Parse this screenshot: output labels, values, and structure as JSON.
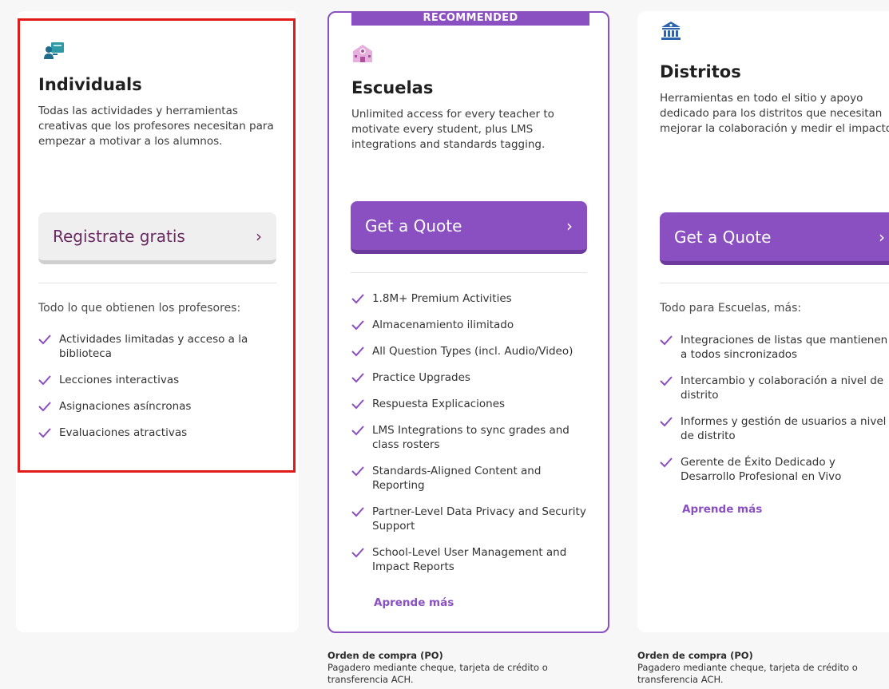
{
  "individuals": {
    "title": "Individuals",
    "description": "Todas las actividades y herramientas creativas que los profesores necesitan para empezar a motivar a los alumnos.",
    "button_label": "Registrate gratis",
    "section_head": "Todo lo que obtienen los profesores:",
    "features": [
      "Actividades limitadas y acceso a la biblioteca",
      "Lecciones interactivas",
      "Asignaciones asíncronas",
      "Evaluaciones atractivas"
    ]
  },
  "escuelas": {
    "badge": "RECOMMENDED",
    "title": "Escuelas",
    "description": "Unlimited access for every teacher to motivate every student, plus LMS integrations and standards tagging.",
    "button_label": "Get a Quote",
    "features": [
      "1.8M+ Premium Activities",
      "Almacenamiento ilimitado",
      "All Question Types (incl. Audio/Video)",
      "Practice Upgrades",
      "Respuesta Explicaciones",
      "LMS Integrations to sync grades and class rosters",
      "Standards-Aligned Content and Reporting",
      "Partner-Level Data Privacy and Security Support",
      "School-Level User Management and Impact Reports"
    ],
    "link": "Aprende más",
    "note_head": "Orden de compra (PO)",
    "note_body": "Pagadero mediante cheque, tarjeta de crédito o transferencia ACH."
  },
  "distritos": {
    "title": "Distritos",
    "description": "Herramientas en todo el sitio y apoyo dedicado para los distritos que necesitan mejorar la colaboración y medir el impacto",
    "button_label": "Get a Quote",
    "section_head": "Todo para Escuelas, más:",
    "features": [
      "Integraciones de listas que mantienen a todos sincronizados",
      "Intercambio y colaboración a nivel de distrito",
      "Informes y gestión de usuarios a nivel de distrito",
      "Gerente de Éxito Dedicado y Desarrollo Profesional en Vivo"
    ],
    "link": "Aprende más",
    "note_head": "Orden de compra (PO)",
    "note_body": "Pagadero mediante cheque, tarjeta de crédito o transferencia ACH."
  },
  "colors": {
    "accent": "#8a4fc1",
    "highlight": "#e11a1a"
  },
  "icons": {
    "individuals": "teacher-board-icon",
    "escuelas": "school-building-icon",
    "distritos": "bank-building-icon",
    "bullet": "checkmark-icon",
    "button": "chevron-right-icon"
  }
}
